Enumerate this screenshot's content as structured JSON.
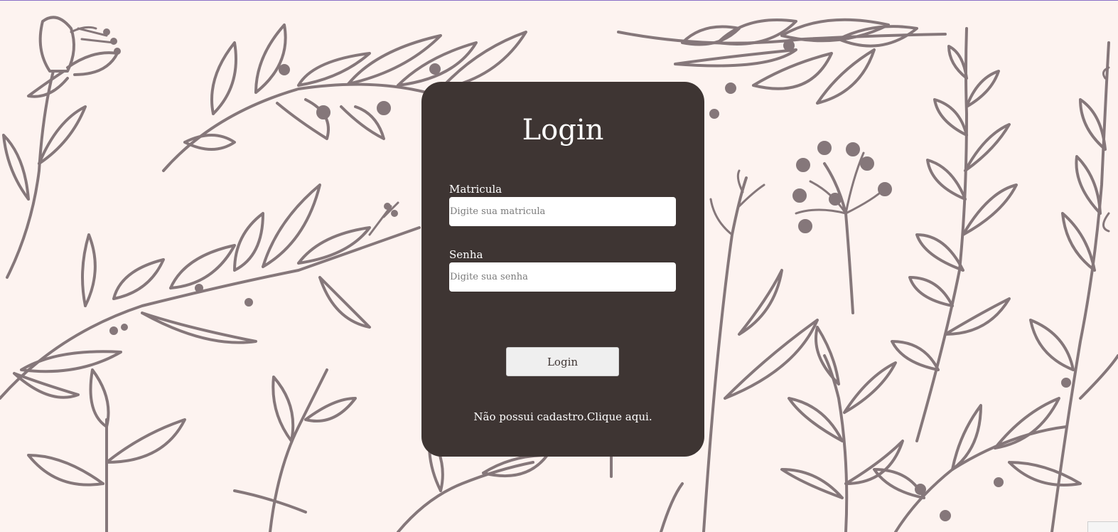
{
  "login": {
    "title": "Login",
    "matricula_label": "Matricula",
    "matricula_placeholder": "Digite sua matricula",
    "senha_label": "Senha",
    "senha_placeholder": "Digite sua senha",
    "button_label": "Login",
    "signup_text": "Não possui cadastro.Clique aqui."
  },
  "colors": {
    "background": "#fdf3f0",
    "card": "#3e3533",
    "botanical_stroke": "#85777a",
    "button": "#efefef"
  },
  "icons": {
    "background": "botanical-line-art"
  }
}
